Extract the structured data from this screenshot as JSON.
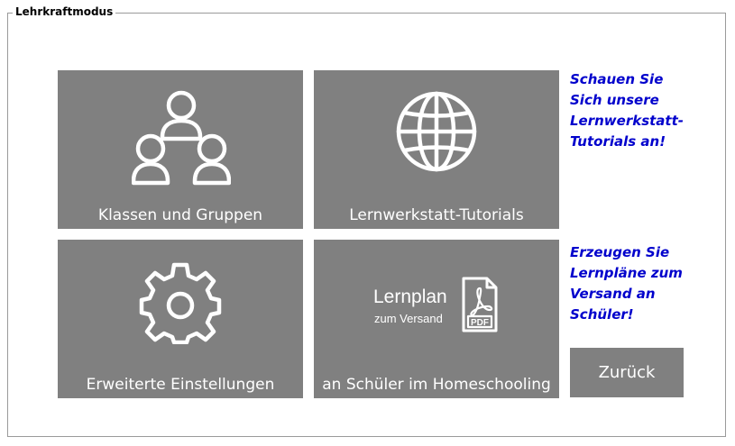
{
  "frame": {
    "title": "Lehrkraftmodus"
  },
  "tiles": {
    "classes": {
      "label": "Klassen und Gruppen",
      "icon": "users-group-icon"
    },
    "tutorials": {
      "label": "Lernwerkstatt-Tutorials",
      "icon": "globe-icon"
    },
    "settings": {
      "label": "Erweiterte Einstellungen",
      "icon": "gear-icon"
    },
    "homeschooling": {
      "label": "an Schüler im Homeschooling",
      "icon": "pdf-file-icon",
      "title": "Lernplan",
      "subtitle": "zum Versand",
      "pdf_text": "PDF"
    }
  },
  "hints": {
    "tutorials": [
      "Schauen Sie",
      "Sich unsere",
      "Lernwerkstatt-",
      "Tutorials an!"
    ],
    "lernplan": [
      "Erzeugen Sie",
      "Lernpläne zum",
      "Versand an",
      "Schüler!"
    ]
  },
  "back_button": {
    "label": "Zurück"
  },
  "colors": {
    "tile": "#808080",
    "hint": "#0000cc",
    "icon": "#ffffff"
  }
}
